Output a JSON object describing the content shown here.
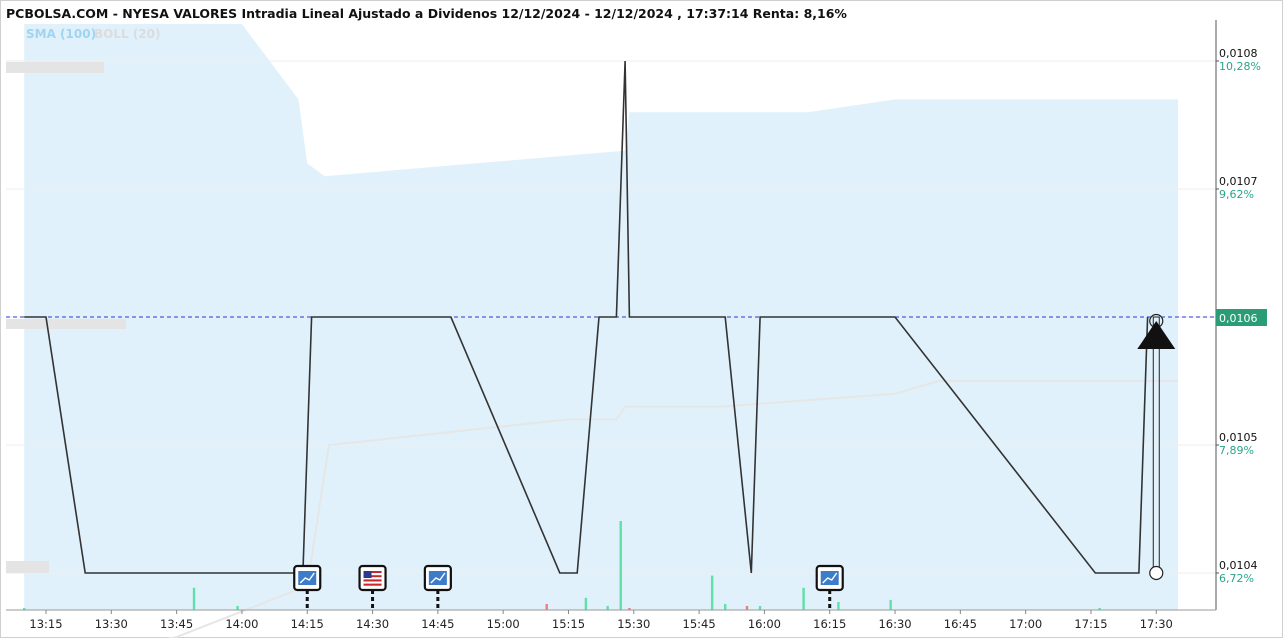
{
  "title": "PCBOLSA.COM - NYESA VALORES Intradia Lineal Ajustado a Dividenos 12/12/2024 - 12/12/2024 , 17:37:14 Renta: 8,16%",
  "legend": {
    "sma_label": "SMA (100)",
    "boll_label": "BOLL (20)",
    "sma_color": "#9fd4f2",
    "boll_color": "#dcdcdc"
  },
  "colors": {
    "price_line": "#333333",
    "band_fill": "#e0f1fb",
    "sma_line": "#e6e6e6",
    "last_price_line": "#2b35d6",
    "last_price_badge": "#2a9d77",
    "pct_text": "#2aa58b",
    "volume_up": "#5fe0a8",
    "volume_down": "#f07d7d"
  },
  "events": [
    {
      "time": "14:15",
      "icon": "news-chart-icon"
    },
    {
      "time": "14:30",
      "icon": "us-flag-icon"
    },
    {
      "time": "14:45",
      "icon": "news-chart-icon"
    },
    {
      "time": "16:15",
      "icon": "news-chart-icon"
    }
  ],
  "chart_data": {
    "type": "line",
    "title": "PCBOLSA.COM - NYESA VALORES Intradia Lineal Ajustado a Dividenos 12/12/2024 - 12/12/2024 , 17:37:14 Renta: 8,16%",
    "x_ticks": [
      "13:15",
      "13:30",
      "13:45",
      "14:00",
      "14:15",
      "14:30",
      "14:45",
      "15:00",
      "15:15",
      "15:30",
      "15:45",
      "16:00",
      "16:15",
      "16:30",
      "16:45",
      "17:00",
      "17:15",
      "17:30"
    ],
    "y_ticks": [
      "0,0108",
      "0,0107",
      "0,0105",
      "0,0104"
    ],
    "y_pct": [
      "10,28%",
      "9,62%",
      "7,89%",
      "6,72%"
    ],
    "ylim": [
      0.01033,
      0.01082
    ],
    "last_price_label": "0,0106",
    "last_price": 0.0106,
    "price_series": [
      {
        "t": "13:10",
        "v": 0.0106
      },
      {
        "t": "13:15",
        "v": 0.0106
      },
      {
        "t": "13:24",
        "v": 0.0104
      },
      {
        "t": "14:14",
        "v": 0.0104
      },
      {
        "t": "14:16",
        "v": 0.0106
      },
      {
        "t": "14:48",
        "v": 0.0106
      },
      {
        "t": "15:13",
        "v": 0.0104
      },
      {
        "t": "15:17",
        "v": 0.0104
      },
      {
        "t": "15:22",
        "v": 0.0106
      },
      {
        "t": "15:26",
        "v": 0.0106
      },
      {
        "t": "15:28",
        "v": 0.0108
      },
      {
        "t": "15:29",
        "v": 0.0106
      },
      {
        "t": "15:51",
        "v": 0.0106
      },
      {
        "t": "15:57",
        "v": 0.0104
      },
      {
        "t": "15:59",
        "v": 0.0106
      },
      {
        "t": "16:30",
        "v": 0.0106
      },
      {
        "t": "17:16",
        "v": 0.0104
      },
      {
        "t": "17:26",
        "v": 0.0104
      },
      {
        "t": "17:28",
        "v": 0.0106
      }
    ],
    "bollinger_upper": [
      {
        "t": "13:10",
        "v": 0.01083
      },
      {
        "t": "14:00",
        "v": 0.01083
      },
      {
        "t": "14:13",
        "v": 0.01077
      },
      {
        "t": "14:15",
        "v": 0.01072
      },
      {
        "t": "14:19",
        "v": 0.01071
      },
      {
        "t": "15:28",
        "v": 0.01073
      },
      {
        "t": "15:29",
        "v": 0.01076
      },
      {
        "t": "15:58",
        "v": 0.01076
      },
      {
        "t": "16:00",
        "v": 0.01076
      },
      {
        "t": "16:10",
        "v": 0.01076
      },
      {
        "t": "16:30",
        "v": 0.01077
      },
      {
        "t": "17:35",
        "v": 0.01077
      }
    ],
    "sma_series": [
      {
        "t": "13:15",
        "v": 0.01033
      },
      {
        "t": "13:45",
        "v": 0.01035
      },
      {
        "t": "14:00",
        "v": 0.01037
      },
      {
        "t": "14:15",
        "v": 0.01039
      },
      {
        "t": "14:20",
        "v": 0.0105
      },
      {
        "t": "15:15",
        "v": 0.01052
      },
      {
        "t": "15:26",
        "v": 0.01052
      },
      {
        "t": "15:28",
        "v": 0.01053
      },
      {
        "t": "15:50",
        "v": 0.01053
      },
      {
        "t": "16:30",
        "v": 0.01054
      },
      {
        "t": "16:40",
        "v": 0.01055
      },
      {
        "t": "17:35",
        "v": 0.01055
      }
    ],
    "volume": [
      {
        "t": "13:10",
        "v": 1,
        "dir": "up"
      },
      {
        "t": "13:49",
        "v": 11,
        "dir": "up"
      },
      {
        "t": "13:59",
        "v": 2,
        "dir": "up"
      },
      {
        "t": "15:10",
        "v": 3,
        "dir": "down"
      },
      {
        "t": "15:19",
        "v": 6,
        "dir": "up"
      },
      {
        "t": "15:24",
        "v": 2,
        "dir": "up"
      },
      {
        "t": "15:27",
        "v": 44,
        "dir": "up"
      },
      {
        "t": "15:29",
        "v": 1,
        "dir": "down"
      },
      {
        "t": "15:48",
        "v": 17,
        "dir": "up"
      },
      {
        "t": "15:51",
        "v": 3,
        "dir": "up"
      },
      {
        "t": "15:56",
        "v": 2,
        "dir": "down"
      },
      {
        "t": "15:59",
        "v": 2,
        "dir": "up"
      },
      {
        "t": "16:09",
        "v": 11,
        "dir": "up"
      },
      {
        "t": "16:17",
        "v": 4,
        "dir": "up"
      },
      {
        "t": "16:29",
        "v": 5,
        "dir": "up"
      },
      {
        "t": "17:17",
        "v": 1,
        "dir": "up"
      }
    ]
  }
}
